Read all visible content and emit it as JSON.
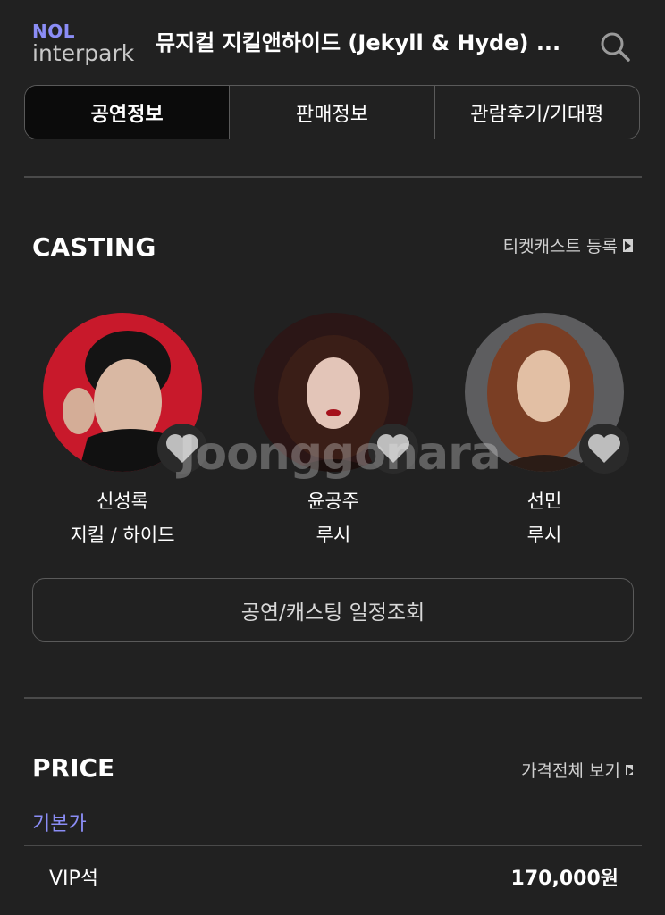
{
  "colors": {
    "background": "#212121",
    "accent": "#8b8df6",
    "active_tab": "#0b0b0b"
  },
  "header": {
    "logo_top": "NOL",
    "logo_bottom": "interpark",
    "title": "뮤지컬 지킬앤하이드 (Jekyll & Hyde) ...",
    "search_icon": "search-icon"
  },
  "tabs": [
    {
      "label": "공연정보",
      "active": true
    },
    {
      "label": "판매정보",
      "active": false
    },
    {
      "label": "관람후기/기대평",
      "active": false
    }
  ],
  "casting": {
    "title": "CASTING",
    "link_label": "티켓캐스트 등록",
    "cast": [
      {
        "name": "신성록",
        "role": "지킬 / 하이드"
      },
      {
        "name": "윤공주",
        "role": "루시"
      },
      {
        "name": "선민",
        "role": "루시"
      }
    ],
    "schedule_button": "공연/캐스팅 일정조회"
  },
  "watermark": "Joonggonara",
  "price": {
    "title": "PRICE",
    "link_label": "가격전체 보기",
    "subtitle": "기본가",
    "rows": [
      {
        "seat": "VIP석",
        "amount": "170,000원"
      }
    ]
  }
}
